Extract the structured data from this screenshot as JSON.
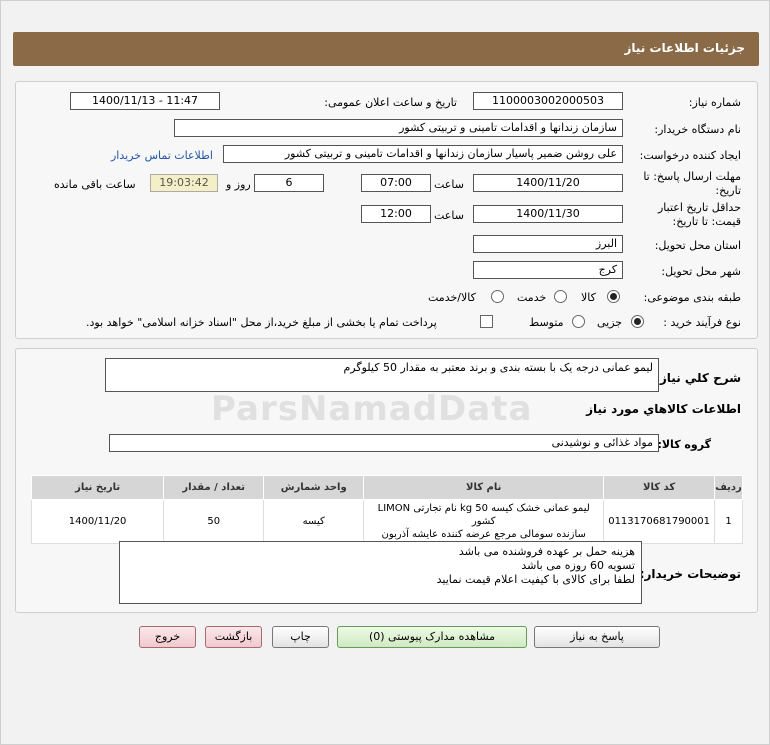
{
  "header": {
    "title": "جزئیات اطلاعات نیاز"
  },
  "form": {
    "need_number_label": "شماره نیاز:",
    "need_number": "1100003002000503",
    "announce_label": "تاریخ و ساعت اعلان عمومی:",
    "announce_value": "1400/11/13 - 11:47",
    "buyer_org_label": "نام دستگاه خریدار:",
    "buyer_org": "سازمان زندانها و اقدامات تامینی و تربیتی کشور",
    "creator_label": "ایجاد کننده درخواست:",
    "creator": "علی روشن ضمیر پاسیار سازمان زندانها و اقدامات تامینی و تربیتی کشور",
    "contact_link": "اطلاعات تماس خریدار",
    "deadline_label_1": "مهلت ارسال پاسخ: تا",
    "deadline_label_2": "تاریخ:",
    "deadline_date": "1400/11/20",
    "hour_label": "ساعت",
    "deadline_time": "07:00",
    "days": "6",
    "days_label": "روز و",
    "remaining_time": "19:03:42",
    "remaining_label": "ساعت باقی مانده",
    "validity_label_1": "حداقل تاریخ اعتبار",
    "validity_label_2": "قیمت: تا تاریخ:",
    "validity_date": "1400/11/30",
    "validity_time": "12:00",
    "province_label": "استان محل تحویل:",
    "province": "البرز",
    "city_label": "شهر محل تحویل:",
    "city": "کرج",
    "category_label": "طبقه بندی موضوعی:",
    "cat_goods": "کالا",
    "cat_service": "خدمت",
    "cat_goods_service": "کالا/خدمت",
    "process_label": "نوع فرآیند خرید :",
    "proc_small": "جزیی",
    "proc_medium": "متوسط",
    "payment_note": "پرداخت تمام یا بخشی از مبلغ خرید،از محل \"اسناد خزانه اسلامی\" خواهد بود."
  },
  "summary": {
    "label": "شرح کلي نياز:",
    "value": "لیمو عمانی درجه یک با بسته بندی و برند معتبر به مقدار 50 کیلوگرم",
    "items_title": "اطلاعات کالاهاي مورد نياز",
    "group_label": "گروه کالا:",
    "group_value": "مواد غذائی و نوشیدنی"
  },
  "table": {
    "headers": [
      "ردیف",
      "کد کالا",
      "نام کالا",
      "واحد شمارش",
      "تعداد / مقدار",
      "تاریخ نیاز"
    ],
    "rows": [
      {
        "idx": "1",
        "code": "0113170681790001",
        "name_1": "لیمو عمانی خشک کیسه 50 kg نام تجارتی LIMON کشور",
        "name_2": "سازنده سومالی مرجع عرضه کننده عایشه آذربون",
        "unit": "کیسه",
        "qty": "50",
        "date": "1400/11/20"
      }
    ]
  },
  "notes": {
    "label": "توضیحات خریدار:",
    "line_1": "هزینه حمل بر عهده فروشنده می باشد",
    "line_2": "تسویه 60 روزه می باشد",
    "line_3": "لطفا برای کالای با کیفیت اعلام قیمت نمایید"
  },
  "buttons": {
    "reply": "پاسخ به نیاز",
    "attachments": "مشاهده مدارک پیوستی (0)",
    "print": "چاپ",
    "back": "بازگشت",
    "exit": "خروج"
  },
  "watermark": "ParsNamadData"
}
